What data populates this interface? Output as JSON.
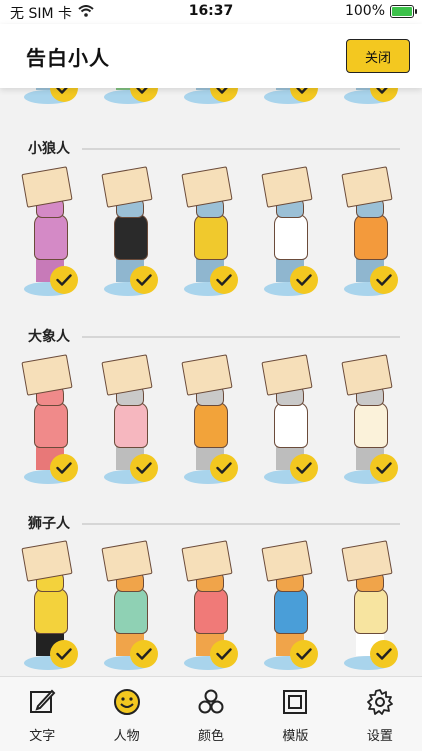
{
  "status": {
    "carrier": "无 SIM 卡",
    "time": "16:37",
    "battery": "100%"
  },
  "header": {
    "title": "告白小人",
    "close_label": "关闭"
  },
  "sections": [
    {
      "title": "小狼人",
      "characters": [
        {
          "body": "#d48ac6",
          "head": "#d48ac6",
          "legs": "#c77ab8"
        },
        {
          "body": "#2a2a2a",
          "head": "#9bc0d6",
          "legs": "#8fb6cf"
        },
        {
          "body": "#f0c92d",
          "head": "#9bc0d6",
          "legs": "#8fb6cf"
        },
        {
          "body": "#ffffff",
          "head": "#9bc0d6",
          "legs": "#8fb6cf"
        },
        {
          "body": "#f39a3c",
          "head": "#9bc0d6",
          "legs": "#8fb6cf"
        }
      ]
    },
    {
      "title": "大象人",
      "characters": [
        {
          "body": "#f08a8a",
          "head": "#f08a8a",
          "legs": "#e87878"
        },
        {
          "body": "#f6b7bf",
          "head": "#c9c9c9",
          "legs": "#bdbdbd"
        },
        {
          "body": "#f2a33a",
          "head": "#c9c9c9",
          "legs": "#bdbdbd"
        },
        {
          "body": "#ffffff",
          "head": "#c9c9c9",
          "legs": "#bdbdbd"
        },
        {
          "body": "#fbf2da",
          "head": "#c9c9c9",
          "legs": "#bdbdbd"
        }
      ]
    },
    {
      "title": "狮子人",
      "characters": [
        {
          "body": "#f3d23c",
          "head": "#f3d23c",
          "legs": "#222222"
        },
        {
          "body": "#8fd1b4",
          "head": "#f0a44a",
          "legs": "#f0a44a"
        },
        {
          "body": "#f07a78",
          "head": "#f0a44a",
          "legs": "#f0a44a"
        },
        {
          "body": "#4a9ed8",
          "head": "#f0a44a",
          "legs": "#f0a44a"
        },
        {
          "body": "#f7e4a0",
          "head": "#f0a44a",
          "legs": "#ffffff"
        }
      ]
    }
  ],
  "top_partial_row": [
    {
      "body": "#9bc0d6"
    },
    {
      "body": "#7fbf7f"
    },
    {
      "body": "#9bc0d6"
    },
    {
      "body": "#9bc0d6"
    },
    {
      "body": "#9bc0d6"
    }
  ],
  "tabs": [
    {
      "label": "文字",
      "icon": "edit-icon"
    },
    {
      "label": "人物",
      "icon": "smiley-icon"
    },
    {
      "label": "颜色",
      "icon": "palette-icon"
    },
    {
      "label": "模版",
      "icon": "template-icon"
    },
    {
      "label": "设置",
      "icon": "gear-icon"
    }
  ],
  "colors": {
    "accent": "#f3c820",
    "background": "#f2f2f2"
  }
}
